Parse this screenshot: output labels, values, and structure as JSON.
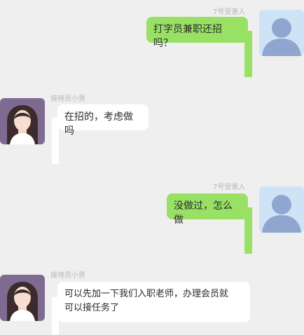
{
  "chat": {
    "messages": [
      {
        "side": "right",
        "sender": "7号受害人",
        "text": "打字员兼职还招吗？",
        "avatar_icon": "default-user-avatar-icon"
      },
      {
        "side": "left",
        "sender": "接待员小贾",
        "text": "在招的，考虑做吗",
        "avatar_icon": "female-avatar-icon"
      },
      {
        "side": "right",
        "sender": "7号受害人",
        "text": "没做过，怎么做",
        "avatar_icon": "default-user-avatar-icon"
      },
      {
        "side": "left",
        "sender": "接待员小贾",
        "text_line1": "可以先加一下我们入职老师，办理会员就",
        "text_line2": "可以接任务了",
        "avatar_icon": "female-avatar-icon"
      }
    ]
  },
  "colors": {
    "background": "#efefef",
    "right_bubble": "#98e165",
    "left_bubble": "#ffffff",
    "sender_name": "#b7b7b7",
    "default_avatar_bg": "#cfe3f7",
    "default_avatar_figure": "#8fa6cf",
    "female_avatar_bg": "#7f6a92"
  }
}
